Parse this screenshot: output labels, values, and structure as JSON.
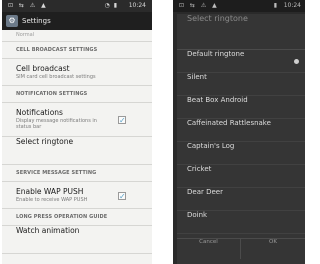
{
  "left": {
    "status_icons": "⊡ ⇆ ⚠ ▲",
    "status_signal": "◔ ▮",
    "status_time": "10:24",
    "app_icon": "⚙",
    "title": "Settings",
    "cut_text": "Normal",
    "sections": {
      "cell_broadcast_header": "CELL BROADCAST SETTINGS",
      "cell_broadcast_title": "Cell broadcast",
      "cell_broadcast_summary": "SIM card cell broadcast settings",
      "notification_header": "NOTIFICATION SETTINGS",
      "notifications_title": "Notifications",
      "notifications_summary": "Display message notifications in status bar",
      "notifications_check": "✓",
      "select_ringtone": "Select ringtone",
      "service_header": "SERVICE MESSAGE SETTING",
      "wap_title": "Enable WAP PUSH",
      "wap_summary": "Enable to receive WAP PUSH",
      "wap_check": "✓",
      "long_press_header": "LONG PRESS OPERATION GUIDE",
      "watch_animation": "Watch animation"
    }
  },
  "right": {
    "status_icons": "⊡ ⇆ ⚠ ▲",
    "status_signal": "▮",
    "status_time": "10:24",
    "dialog_title": "Select ringtone",
    "ringtones": [
      "Default ringtone",
      "Silent",
      "Beat Box Android",
      "Caffeinated Rattlesnake",
      "Captain's Log",
      "Cricket",
      "Dear Deer",
      "Doink"
    ],
    "cancel_label": "Cancel",
    "ok_label": "OK"
  }
}
